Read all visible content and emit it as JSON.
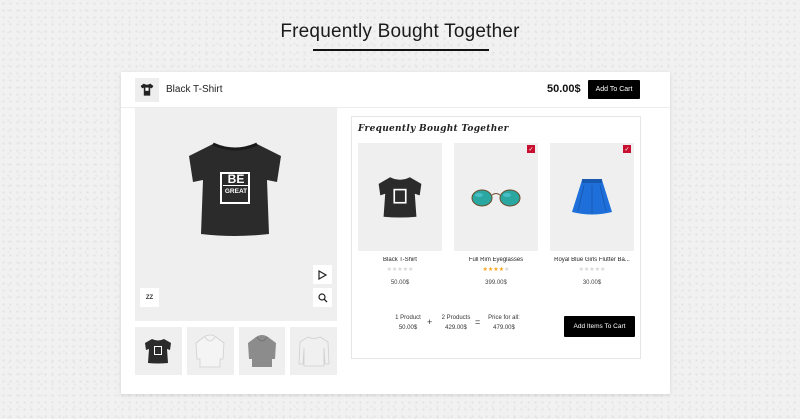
{
  "page": {
    "title": "Frequently Bought Together"
  },
  "topbar": {
    "product_name": "Black T-Shirt",
    "price": "50.00$",
    "add_to_cart_label": "Add To Cart",
    "thumb_icon": "tshirt-icon"
  },
  "gallery": {
    "main_image": "black-tshirt-be-great",
    "shirt_print": [
      "BE",
      "GREAT"
    ],
    "badge_text": "ZZ",
    "play_icon": "play-icon",
    "zoom_icon": "search-icon",
    "thumbnails": [
      "black-tshirt",
      "white-hoodie",
      "grey-hoodie",
      "white-sweatshirt"
    ]
  },
  "fbt": {
    "heading": "Frequently Bought Together",
    "products": [
      {
        "name": "Black T-Shirt",
        "price": "50.00$",
        "rating": 0,
        "checked": false,
        "image": "black-tshirt"
      },
      {
        "name": "Full Rim Eyeglasses",
        "price": "399.00$",
        "rating": 4,
        "checked": true,
        "image": "eyeglasses"
      },
      {
        "name": "Royal Blue Girls Flutter Ba...",
        "price": "30.00$",
        "rating": 0,
        "checked": true,
        "image": "blue-skirt"
      }
    ],
    "summary": {
      "one_label": "1 Product",
      "one_price": "50.00$",
      "plus": "+",
      "two_label": "2 Products",
      "two_price": "429.00$",
      "equals": "=",
      "total_label": "Price for all:",
      "total_price": "479.00$"
    },
    "add_items_label": "Add Items To Cart"
  },
  "colors": {
    "accent_button": "#000000",
    "check": "#c8102e",
    "star_filled": "#f5a623",
    "star_empty": "#d6d6d6"
  }
}
